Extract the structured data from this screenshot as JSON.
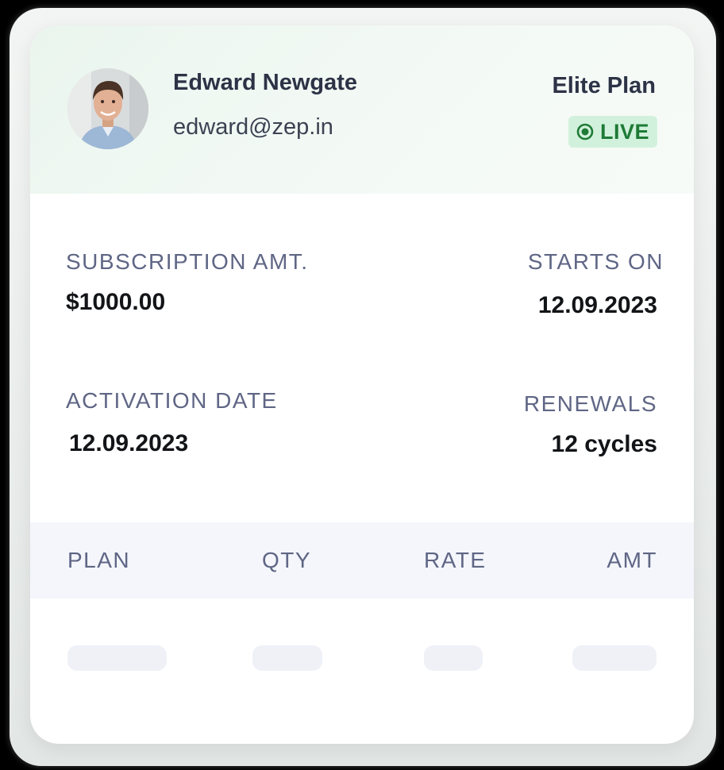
{
  "profile": {
    "name": "Edward Newgate",
    "email": "edward@zep.in",
    "avatar_icon": "person-photo"
  },
  "plan": {
    "name": "Elite Plan",
    "status": "LIVE",
    "status_icon": "live-dot-icon",
    "status_color": "#1e7a36",
    "status_bg": "#d2f1dc"
  },
  "details": {
    "subscription_amt_label": "SUBSCRIPTION AMT.",
    "subscription_amt_value": "$1000.00",
    "starts_on_label": "STARTS ON",
    "starts_on_value": "12.09.2023",
    "activation_date_label": "ACTIVATION DATE",
    "activation_date_value": "12.09.2023",
    "renewals_label": "RENEWALS",
    "renewals_value": "12 cycles"
  },
  "table": {
    "headers": [
      "PLAN",
      "QTY",
      "RATE",
      "AMT"
    ]
  },
  "colors": {
    "label": "#5f6685",
    "value": "#121417",
    "header_bg": "#f4f6fb",
    "skeleton": "#eff1f7"
  }
}
